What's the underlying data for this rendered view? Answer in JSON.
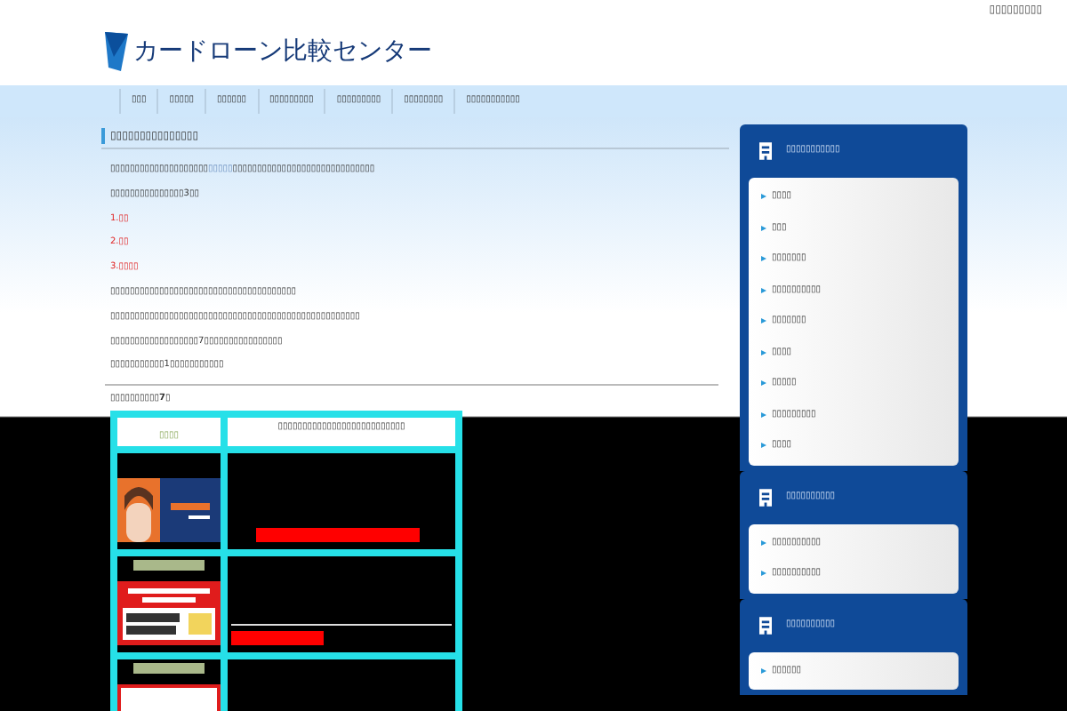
{
  "header": {
    "top_link": "▯▯▯▯▯▯▯▯▯",
    "logo": "カードローン比較センター"
  },
  "nav": [
    "▯▯▯",
    "▯▯▯▯▯",
    "▯▯▯▯▯▯",
    "▯▯▯▯▯▯▯▯▯",
    "▯▯▯▯▯▯▯▯▯",
    "▯▯▯▯▯▯▯▯",
    "▯▯▯▯▯▯▯▯▯▯▯"
  ],
  "article": {
    "title": "▯▯▯▯▯▯▯▯▯▯▯▯▯▯▯",
    "lines": [
      {
        "kind": "link",
        "before": "▯▯▯▯▯▯▯▯▯▯▯▯▯▯▯▯▯▯▯▯",
        "link": "▯▯▯▯▯",
        "after": "▯▯▯▯▯▯▯▯▯▯▯▯▯▯▯▯▯▯▯▯▯▯▯▯▯▯▯▯▯"
      },
      {
        "kind": "text",
        "text": "▯▯▯▯▯▯▯▯▯▯▯▯▯▯▯3▯▯"
      },
      {
        "kind": "red",
        "text": "1.▯▯"
      },
      {
        "kind": "red",
        "text": "2.▯▯"
      },
      {
        "kind": "red",
        "text": "3.▯▯▯▯"
      },
      {
        "kind": "text",
        "text": "▯▯▯▯▯▯▯▯▯▯▯▯▯▯▯▯▯▯▯▯▯▯▯▯▯▯▯▯▯▯▯▯▯▯▯▯▯▯"
      },
      {
        "kind": "text",
        "text": "▯▯▯▯▯▯▯▯▯▯▯▯▯▯▯▯▯▯▯▯▯▯▯▯▯▯▯▯▯▯▯▯▯▯▯▯▯▯▯▯▯▯▯▯▯▯▯▯▯▯▯"
      },
      {
        "kind": "text",
        "text": "▯▯▯▯▯▯▯▯▯▯▯▯▯▯▯▯▯▯7▯▯▯▯▯▯▯▯▯▯▯▯▯▯▯▯"
      },
      {
        "kind": "text",
        "text": "▯▯▯▯▯▯▯▯▯▯▯1▯▯▯▯▯▯▯▯▯▯▯"
      }
    ],
    "ranking_heading": "▯▯▯▯▯▯▯▯▯▯**7**▯"
  },
  "table": {
    "header": [
      "▯▯▯▯",
      "▯▯▯▯▯▯▯▯▯▯▯▯▯▯▯▯▯▯▯▯▯▯▯▯▯▯"
    ],
    "rows": [
      {
        "kind": "picture"
      },
      {
        "kind": "picture"
      },
      {
        "kind": "picture"
      }
    ]
  },
  "sidebar": [
    {
      "title": "▯▯▯▯▯▯▯▯▯▯▯",
      "items": [
        "▯▯▯▯",
        "▯▯▯",
        "▯▯▯▯▯▯▯",
        "▯▯▯▯▯▯▯▯▯▯",
        "▯▯▯▯▯▯▯",
        "▯▯▯▯",
        "▯▯▯▯▯",
        "▯▯▯▯▯▯▯▯▯",
        "▯▯▯▯"
      ]
    },
    {
      "title": "▯▯▯▯▯▯▯▯▯▯",
      "items": [
        "▯▯▯▯▯▯▯▯▯▯",
        "▯▯▯▯▯▯▯▯▯▯"
      ]
    },
    {
      "title": "▯▯▯▯▯▯▯▯▯▯",
      "items": [
        "▯▯▯▯▯▯"
      ]
    }
  ]
}
